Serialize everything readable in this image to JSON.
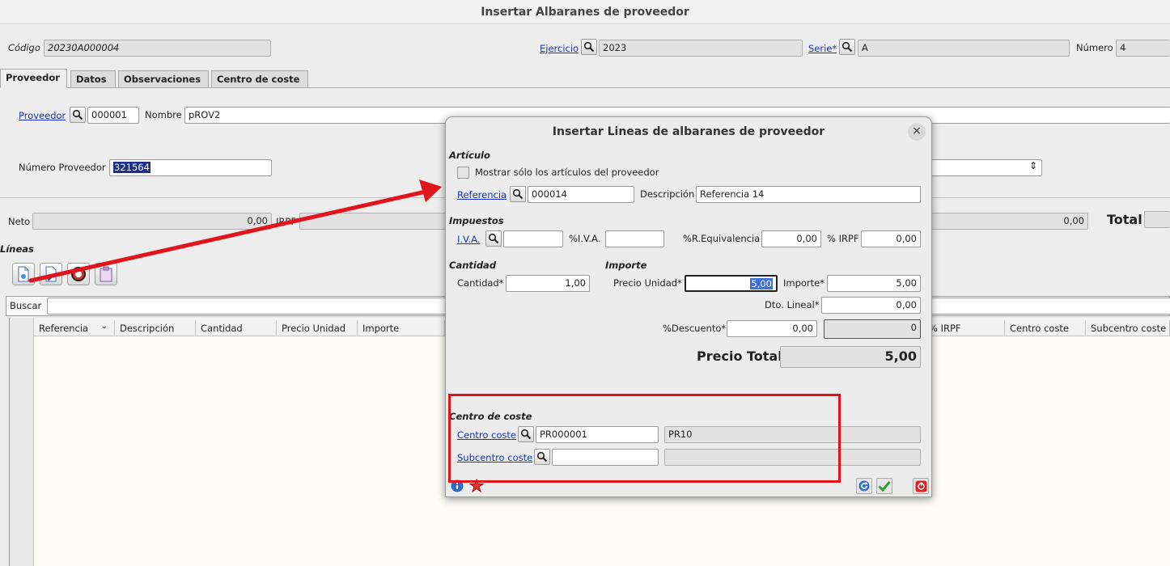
{
  "window": {
    "title": "Insertar Albaranes de proveedor"
  },
  "header": {
    "codigo_label": "Código",
    "codigo_value": "20230A000004",
    "ejercicio_label": "Ejercicio",
    "ejercicio_value": "2023",
    "serie_label": "Serie*",
    "serie_value": "A",
    "numero_label": "Número",
    "numero_value": "4"
  },
  "tabs": [
    {
      "label": "Proveedor",
      "active": true
    },
    {
      "label": "Datos"
    },
    {
      "label": "Observaciones"
    },
    {
      "label": "Centro de coste"
    }
  ],
  "proveedor": {
    "proveedor_label": "Proveedor",
    "proveedor_value": "000001",
    "nombre_label": "Nombre",
    "nombre_value": "pROV2",
    "numero_label": "Número Proveedor",
    "numero_value": "321564"
  },
  "totals": {
    "neto_label": "Neto",
    "neto_value": "0,00",
    "irpf_label": "IRPF",
    "right_value": "0,00",
    "total_label": "Total"
  },
  "lineas": {
    "label": "Líneas",
    "buscar_label": "Buscar",
    "columns": [
      "Referencia",
      "Descripción",
      "Cantidad",
      "Precio Unidad",
      "Importe",
      "% IRPF",
      "Centro coste",
      "Subcentro coste"
    ]
  },
  "dialog": {
    "title": "Insertar Lineas de albaranes de proveedor",
    "articulo_section": "Artículo",
    "mostrar_label": "Mostrar sólo los artículos del proveedor",
    "referencia_label": "Referencia",
    "referencia_value": "000014",
    "descripcion_label": "Descripción",
    "descripcion_value": "Referencia 14",
    "impuestos_section": "Impuestos",
    "iva_label": "I.V.A.",
    "iva_value": "",
    "pct_iva_label": "%I.V.A.",
    "pct_iva_value": "",
    "req_label": "%R.Equivalencia",
    "req_value": "0,00",
    "irpf_label": "% IRPF",
    "irpf_value": "0,00",
    "cantidad_section": "Cantidad",
    "importe_section": "Importe",
    "cantidad_label": "Cantidad*",
    "cantidad_value": "1,00",
    "precio_unidad_label": "Precio Unidad*",
    "precio_unidad_value": "5,00",
    "importe_label": "Importe*",
    "importe_value": "5,00",
    "dto_label": "Dto. Lineal*",
    "dto_value": "0,00",
    "descuento_label": "%Descuento*",
    "descuento_value": "0,00",
    "descuento_amount": "0",
    "precio_total_label": "Precio Total",
    "precio_total_value": "5,00",
    "centro_section": "Centro de coste",
    "centro_label": "Centro coste",
    "centro_value": "PR000001",
    "centro_desc": "PR10",
    "subcentro_label": "Subcentro coste",
    "subcentro_value": "",
    "subcentro_desc": ""
  },
  "colors": {
    "link": "#1a34b8",
    "annotation": "#e0141a",
    "selection": "#1c2f8c"
  }
}
